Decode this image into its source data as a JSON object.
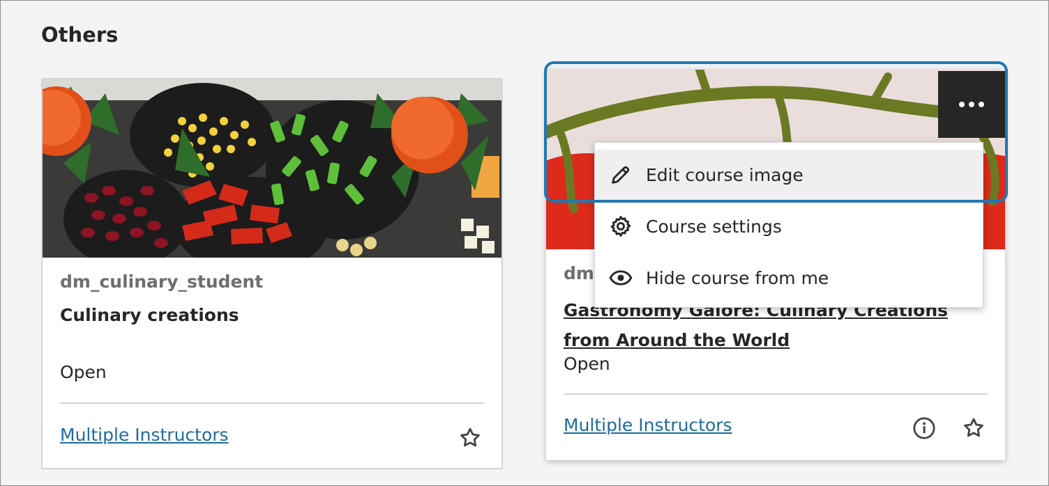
{
  "section": {
    "title": "Others"
  },
  "cards": [
    {
      "code": "dm_culinary_student",
      "title": "Culinary creations",
      "status": "Open",
      "instructors": "Multiple Instructors",
      "star_icon": "star-outline-icon"
    },
    {
      "code": "dm",
      "title": "Gastronomy Galore: Culinary Creations from Around the World",
      "status": "Open",
      "instructors": "Multiple Instructors",
      "info_icon": "info-icon",
      "star_icon": "star-outline-icon"
    }
  ],
  "more_button": {
    "icon": "ellipsis-icon"
  },
  "menu": {
    "items": [
      {
        "label": "Edit course image",
        "icon": "pencil-icon",
        "highlighted": true
      },
      {
        "label": "Course settings",
        "icon": "gear-icon",
        "highlighted": false
      },
      {
        "label": "Hide course from me",
        "icon": "eye-icon",
        "highlighted": false
      }
    ]
  },
  "colors": {
    "link": "#1f6c9f",
    "focus_ring": "#1f78b4",
    "more_button_bg": "#262626"
  }
}
